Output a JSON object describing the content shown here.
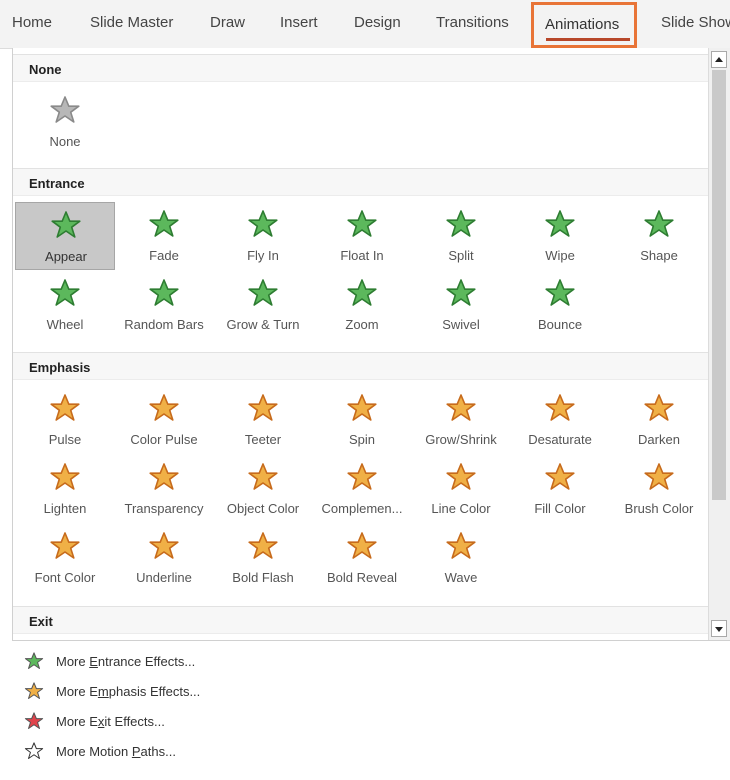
{
  "ribbon": {
    "tabs": [
      "Home",
      "Slide Master",
      "Draw",
      "Insert",
      "Design",
      "Transitions"
    ],
    "active_tab": "Animations",
    "cutoff_tab": "Slide Show"
  },
  "gallery": {
    "none_section": {
      "title": "None",
      "items": [
        {
          "label": "None",
          "icon": "star-none-icon"
        }
      ]
    },
    "entrance": {
      "title": "Entrance",
      "color": "#5cb85c",
      "items": [
        {
          "label": "Appear",
          "icon": "appear-star-icon",
          "selected": true
        },
        {
          "label": "Fade",
          "icon": "fade-star-icon"
        },
        {
          "label": "Fly In",
          "icon": "fly-in-star-icon"
        },
        {
          "label": "Float In",
          "icon": "float-in-star-icon"
        },
        {
          "label": "Split",
          "icon": "split-star-icon"
        },
        {
          "label": "Wipe",
          "icon": "wipe-star-icon"
        },
        {
          "label": "Shape",
          "icon": "shape-star-icon"
        },
        {
          "label": "Wheel",
          "icon": "wheel-star-icon"
        },
        {
          "label": "Random Bars",
          "icon": "random-bars-star-icon"
        },
        {
          "label": "Grow & Turn",
          "icon": "grow-turn-star-icon"
        },
        {
          "label": "Zoom",
          "icon": "zoom-star-icon"
        },
        {
          "label": "Swivel",
          "icon": "swivel-star-icon"
        },
        {
          "label": "Bounce",
          "icon": "bounce-star-icon"
        }
      ]
    },
    "emphasis": {
      "title": "Emphasis",
      "color": "#f0b046",
      "items": [
        {
          "label": "Pulse",
          "icon": "pulse-star-icon"
        },
        {
          "label": "Color Pulse",
          "icon": "color-pulse-star-icon"
        },
        {
          "label": "Teeter",
          "icon": "teeter-star-icon"
        },
        {
          "label": "Spin",
          "icon": "spin-star-icon"
        },
        {
          "label": "Grow/Shrink",
          "icon": "grow-shrink-star-icon"
        },
        {
          "label": "Desaturate",
          "icon": "desaturate-star-icon"
        },
        {
          "label": "Darken",
          "icon": "darken-star-icon"
        },
        {
          "label": "Lighten",
          "icon": "lighten-star-icon"
        },
        {
          "label": "Transparency",
          "icon": "transparency-star-icon"
        },
        {
          "label": "Object Color",
          "icon": "object-color-star-icon"
        },
        {
          "label": "Complemen...",
          "icon": "complementary-color-star-icon"
        },
        {
          "label": "Line Color",
          "icon": "line-color-star-icon"
        },
        {
          "label": "Fill Color",
          "icon": "fill-color-star-icon"
        },
        {
          "label": "Brush Color",
          "icon": "brush-color-star-icon"
        },
        {
          "label": "Font Color",
          "icon": "font-color-star-icon"
        },
        {
          "label": "Underline",
          "icon": "underline-star-icon"
        },
        {
          "label": "Bold Flash",
          "icon": "bold-flash-star-icon"
        },
        {
          "label": "Bold Reveal",
          "icon": "bold-reveal-star-icon"
        },
        {
          "label": "Wave",
          "icon": "wave-star-icon"
        }
      ]
    },
    "exit": {
      "title": "Exit"
    }
  },
  "more": [
    {
      "pre": "More ",
      "acc": "E",
      "post": "ntrance Effects...",
      "icon": "entrance-effects-icon",
      "color": "#5cb85c"
    },
    {
      "pre": "More E",
      "acc": "m",
      "post": "phasis Effects...",
      "icon": "emphasis-effects-icon",
      "color": "#f0b046"
    },
    {
      "pre": "More E",
      "acc": "x",
      "post": "it Effects...",
      "icon": "exit-effects-icon",
      "color": "#e0434b"
    },
    {
      "pre": "More Motion ",
      "acc": "P",
      "post": "aths...",
      "icon": "motion-paths-icon",
      "color": "#ffffff"
    }
  ]
}
